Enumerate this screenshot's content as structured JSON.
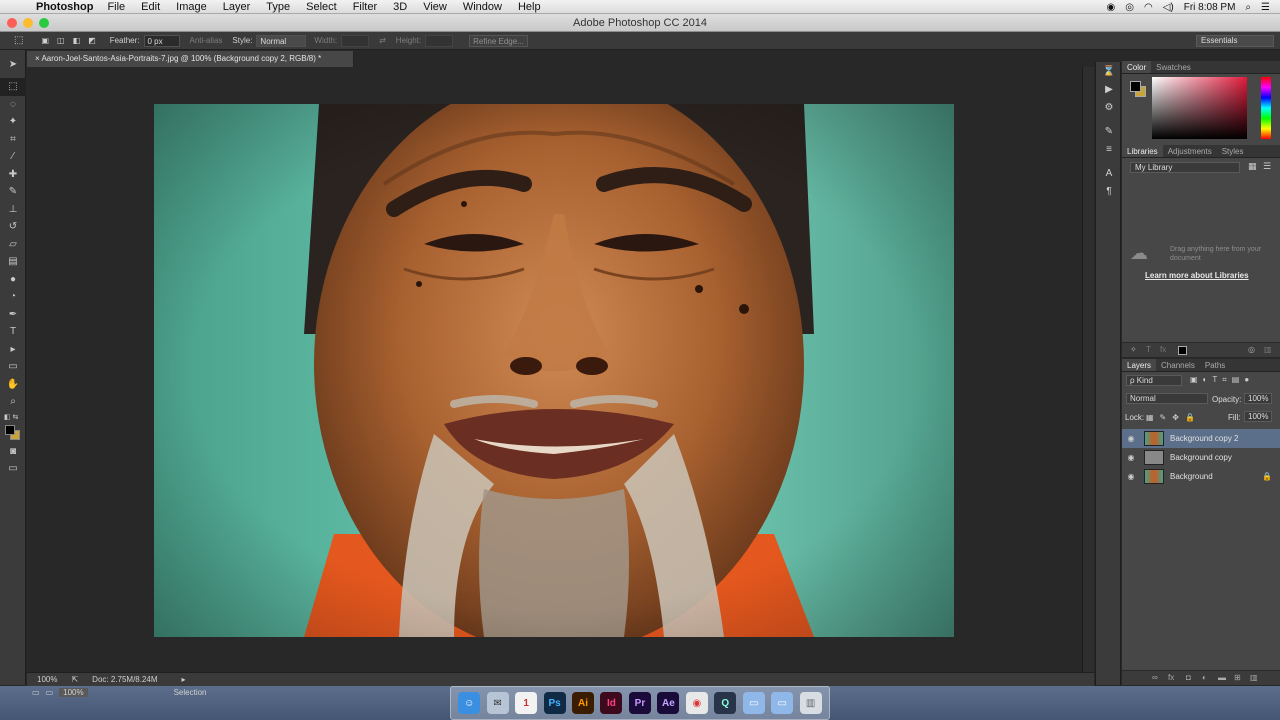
{
  "menubar": {
    "app": "Photoshop",
    "items": [
      "File",
      "Edit",
      "Image",
      "Layer",
      "Type",
      "Select",
      "Filter",
      "3D",
      "View",
      "Window",
      "Help"
    ],
    "clock": "Fri 8:08 PM"
  },
  "window": {
    "title": "Adobe Photoshop CC 2014"
  },
  "options": {
    "feather_label": "Feather:",
    "feather_value": "0 px",
    "antialias": "Anti-alias",
    "style_label": "Style:",
    "style_value": "Normal",
    "width_label": "Width:",
    "height_label": "Height:",
    "refine_edge": "Refine Edge...",
    "workspace": "Essentials"
  },
  "document": {
    "tab": "Aaron-Joel-Santos-Asia-Portraits-7.jpg @ 100% (Background copy 2, RGB/8) *"
  },
  "status": {
    "zoom": "100%",
    "doc": "Doc: 2.75M/8.24M",
    "bottom_zoom": "100%",
    "mode": "Selection"
  },
  "panels": {
    "color_tabs": [
      "Color",
      "Swatches"
    ],
    "library_tabs": [
      "Libraries",
      "Adjustments",
      "Styles"
    ],
    "library_select": "My Library",
    "library_hint": "Drag anything here from your document",
    "library_link": "Learn more about Libraries",
    "layer_tabs": [
      "Layers",
      "Channels",
      "Paths"
    ],
    "kind_filter": "ρ Kind",
    "blend_mode": "Normal",
    "opacity_label": "Opacity:",
    "opacity_value": "100%",
    "lock_label": "Lock:",
    "fill_label": "Fill:",
    "fill_value": "100%"
  },
  "layers": [
    {
      "name": "Background copy 2",
      "selected": true
    },
    {
      "name": "Background copy",
      "selected": false
    },
    {
      "name": "Background",
      "selected": false,
      "locked": true
    }
  ],
  "dock": [
    "Ps",
    "Ai",
    "Id",
    "Pr",
    "Ae"
  ],
  "colors": {
    "foreground": "#000000",
    "background": "#c8a43a",
    "accent": "#5b6f8a"
  }
}
